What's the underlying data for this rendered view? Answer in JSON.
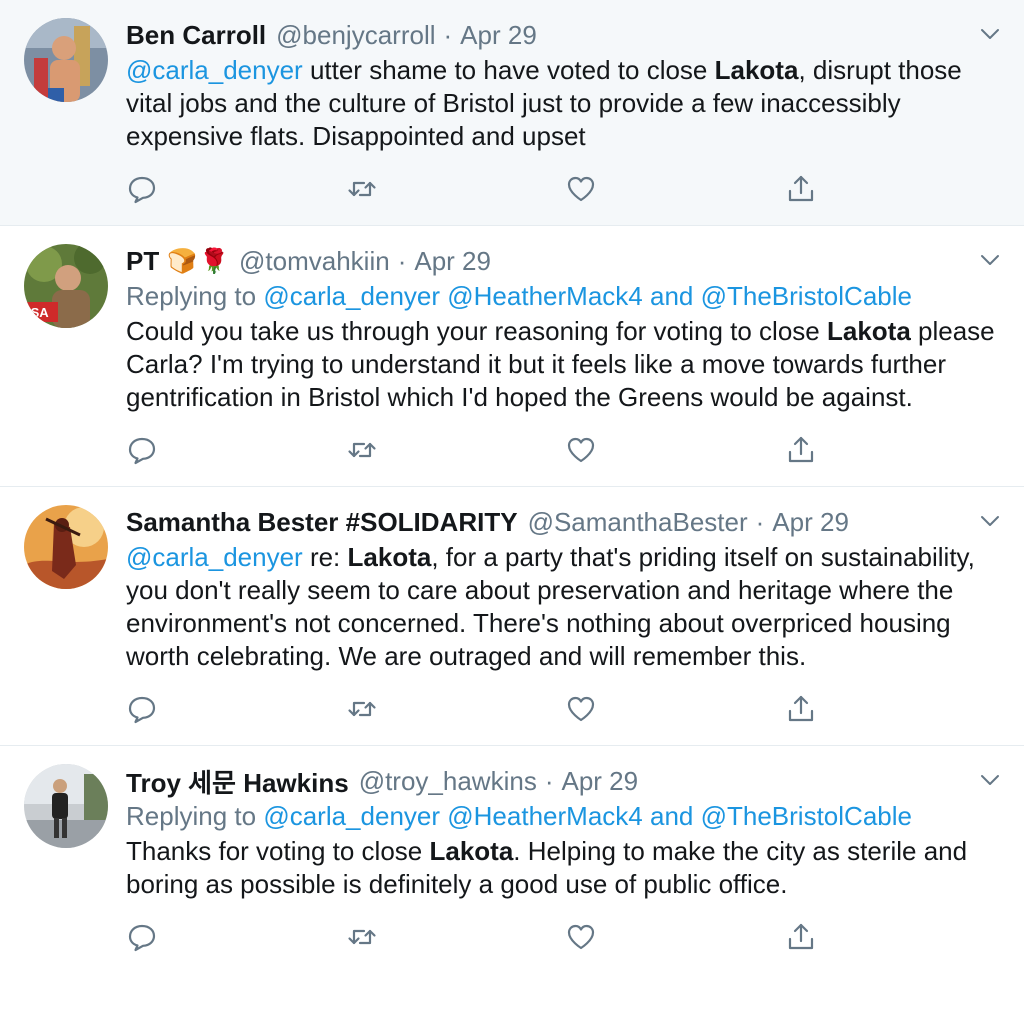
{
  "tweets": [
    {
      "author_name": "Ben Carroll",
      "author_handle": "@benjycarroll",
      "separator": "·",
      "date": "Apr 29",
      "highlighted": true,
      "text_parts": [
        {
          "t": "@carla_denyer",
          "style": "link"
        },
        {
          "t": " utter shame to have voted to close ",
          "style": "plain"
        },
        {
          "t": "Lakota",
          "style": "bold"
        },
        {
          "t": ", disrupt those vital jobs and the culture of Bristol just to provide a few inaccessibly expensive flats. Disappointed and upset",
          "style": "plain"
        }
      ]
    },
    {
      "author_name": "PT",
      "name_emojis": [
        "🍞",
        "🌹"
      ],
      "author_handle": "@tomvahkiin",
      "separator": "·",
      "date": "Apr 29",
      "replying_prefix": "Replying to",
      "replying_to": [
        "@carla_denyer",
        "@HeatherMack4",
        "@TheBristolCable"
      ],
      "replying_and": "and",
      "text_parts": [
        {
          "t": "Could you take us through your reasoning for voting to close ",
          "style": "plain"
        },
        {
          "t": "Lakota",
          "style": "bold"
        },
        {
          "t": " please Carla? I'm trying to understand it but it feels like a move towards further gentrification in Bristol which I'd hoped the Greens would be against.",
          "style": "plain"
        }
      ]
    },
    {
      "author_name": "Samantha Bester #SOLIDARITY",
      "author_handle": "@SamanthaBester",
      "separator": "·",
      "date": "Apr 29",
      "text_parts": [
        {
          "t": "@carla_denyer",
          "style": "link"
        },
        {
          "t": " re: ",
          "style": "plain"
        },
        {
          "t": "Lakota",
          "style": "bold"
        },
        {
          "t": ", for a party that's priding itself on sustainability, you don't really seem to care about preservation and heritage where the environment's not concerned. There's nothing about overpriced housing worth celebrating. We are outraged and will remember this.",
          "style": "plain"
        }
      ]
    },
    {
      "author_name": "Troy 세문 Hawkins",
      "author_handle": "@troy_hawkins",
      "separator": "·",
      "date": "Apr 29",
      "replying_prefix": "Replying to",
      "replying_to": [
        "@carla_denyer",
        "@HeatherMack4",
        "@TheBristolCable"
      ],
      "replying_and": "and",
      "text_parts": [
        {
          "t": "Thanks for voting to close ",
          "style": "plain"
        },
        {
          "t": "Lakota",
          "style": "bold"
        },
        {
          "t": ". Helping to make the city as sterile and boring as possible is definitely a good use of public office.",
          "style": "plain"
        }
      ]
    }
  ],
  "icons": {
    "reply": "reply-icon",
    "retweet": "retweet-icon",
    "like": "like-icon",
    "share": "share-icon",
    "caret": "chevron-down-icon"
  },
  "colors": {
    "link": "#1b95e0",
    "muted": "#657786",
    "text": "#14171a",
    "highlight_bg": "#f5f8fa",
    "divider": "#e6ecf0"
  }
}
